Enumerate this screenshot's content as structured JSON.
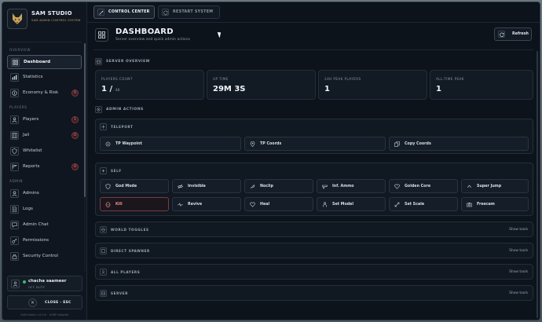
{
  "brand": {
    "title": "SAM STUDIO",
    "subtitle": "SAM ADMIN CONTROL SYSTEM"
  },
  "sidebar": {
    "sections": [
      {
        "label": "OVERVIEW"
      },
      {
        "label": "PLAYERS"
      },
      {
        "label": "ADMIN"
      }
    ],
    "items": [
      {
        "label": "Dashboard",
        "icon": "grid-icon",
        "active": true
      },
      {
        "label": "Statistics",
        "icon": "chart-icon"
      },
      {
        "label": "Economy & Risk",
        "icon": "coin-icon",
        "badge": "0"
      },
      {
        "label": "Players",
        "icon": "users-icon",
        "badge": "1"
      },
      {
        "label": "Jail",
        "icon": "jail-icon",
        "badge": "0"
      },
      {
        "label": "Whitelist",
        "icon": "shield-icon"
      },
      {
        "label": "Reports",
        "icon": "flag-icon",
        "badge": "0"
      },
      {
        "label": "Admins",
        "icon": "admin-icon"
      },
      {
        "label": "Logs",
        "icon": "file-icon"
      },
      {
        "label": "Admin Chat",
        "icon": "chat-icon"
      },
      {
        "label": "Permissions",
        "icon": "key-icon"
      },
      {
        "label": "Security Control",
        "icon": "lock-icon"
      }
    ]
  },
  "user": {
    "name": "chacha saameer",
    "status": "OFF DUTY"
  },
  "close_label": "CLOSE - ESC",
  "version": "SAM Admin v1.0.0 · VORP Adapter",
  "tabs": [
    {
      "label": "CONTROL CENTER",
      "active": true
    },
    {
      "label": "RESTART SYSTEM"
    }
  ],
  "page": {
    "title": "DASHBOARD",
    "subtitle": "Server overview and quick admin actions",
    "refresh_label": "Refresh"
  },
  "server_overview": {
    "heading": "SERVER OVERVIEW",
    "stats": [
      {
        "label": "PLAYERS COUNT",
        "value": "1 /",
        "suffix": "48"
      },
      {
        "label": "UP TIME",
        "value": "29M 3S"
      },
      {
        "label": "24H PEAK PLAYERS",
        "value": "1"
      },
      {
        "label": "ALL-TIME PEAK",
        "value": "1"
      }
    ]
  },
  "admin_actions": {
    "heading": "ADMIN ACTIONS",
    "teleport": {
      "heading": "TELEPORT",
      "buttons": [
        "TP Waypoint",
        "TP Coords",
        "Copy Coords"
      ]
    },
    "self": {
      "heading": "SELF",
      "buttons": [
        "God Mode",
        "Invisible",
        "Noclip",
        "Inf. Ammo",
        "Golden Core",
        "Super Jump",
        "Kill",
        "Revive",
        "Heal",
        "Set Model",
        "Set Scale",
        "Freecam"
      ]
    },
    "collapsed": [
      {
        "heading": "WORLD TOGGLES",
        "action": "Show tools"
      },
      {
        "heading": "DIRECT SPAWNER",
        "action": "Show tools"
      },
      {
        "heading": "ALL PLAYERS",
        "action": "Show tools"
      },
      {
        "heading": "SERVER",
        "action": "Show tools"
      }
    ]
  },
  "colors": {
    "background": "#0d131b",
    "accent_gold": "#c9a35a",
    "danger": "#ea8c92",
    "online": "#3fb870"
  }
}
